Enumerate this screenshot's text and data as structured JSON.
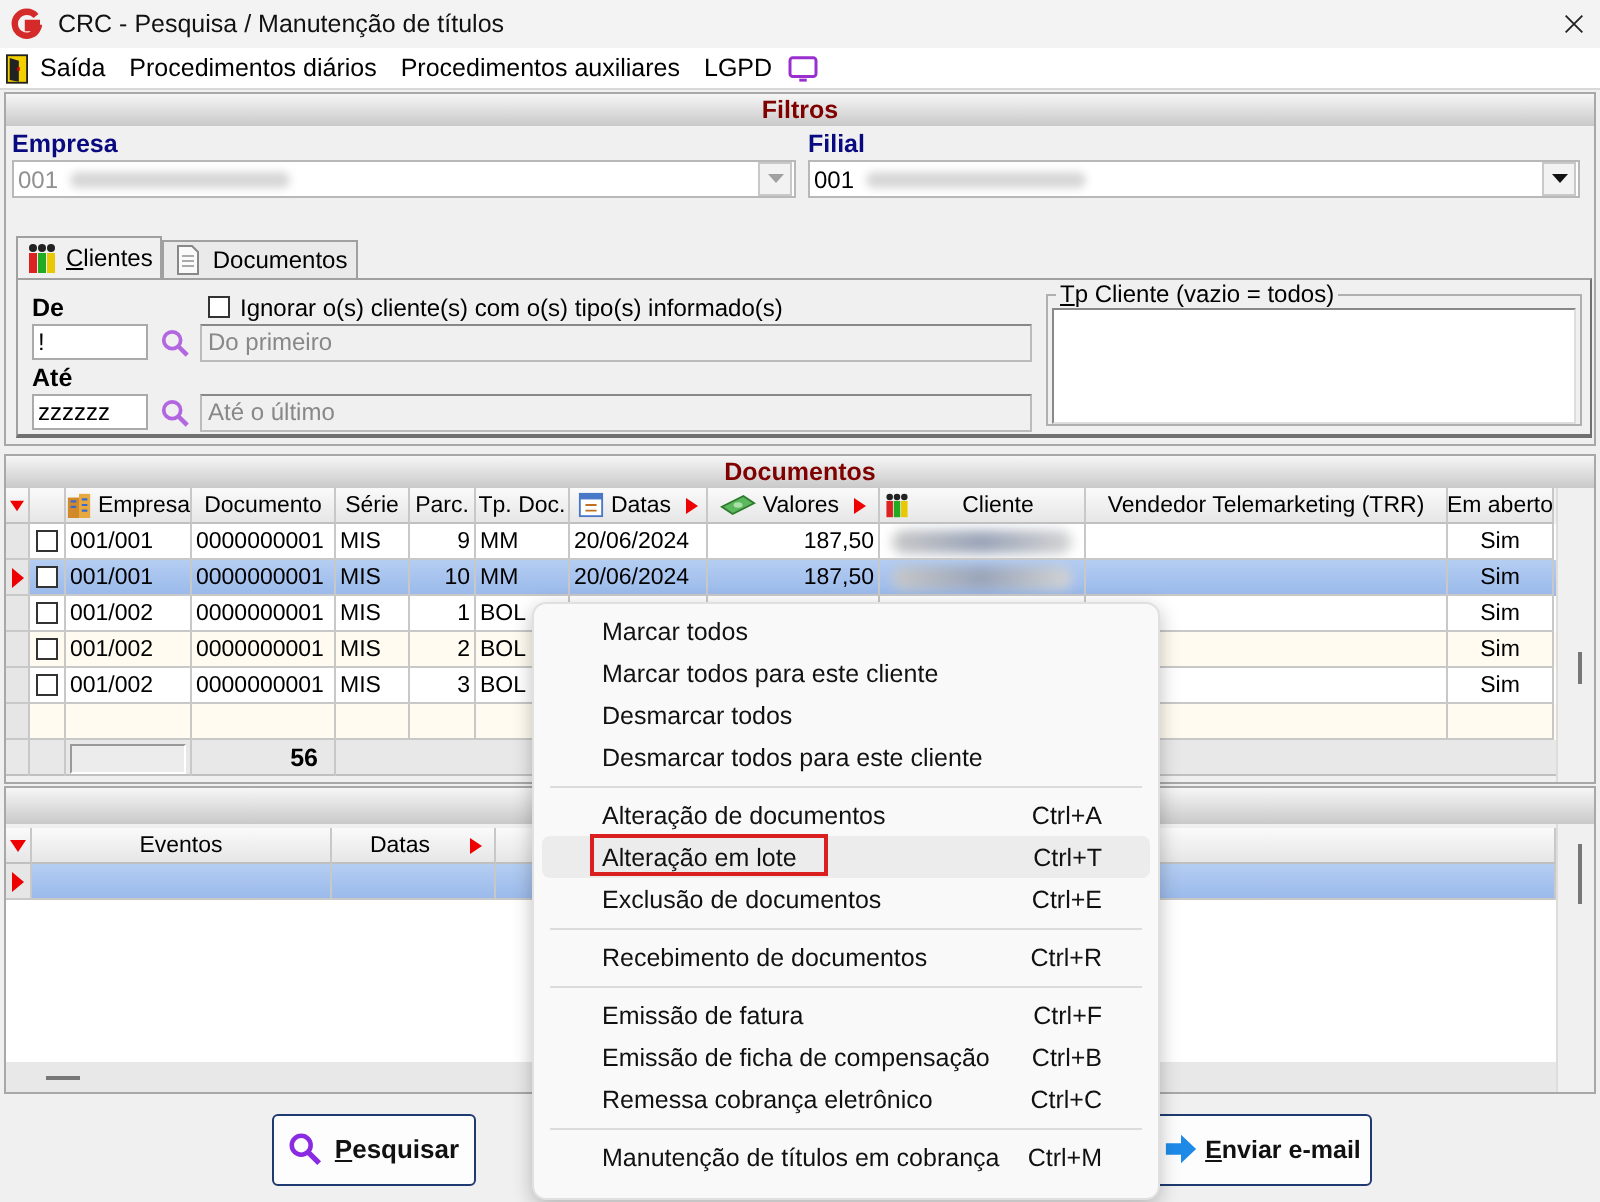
{
  "window": {
    "title": "CRC - Pesquisa / Manutenção de títulos"
  },
  "menu_bar": [
    {
      "label": "Saída"
    },
    {
      "label": "Procedimentos diários"
    },
    {
      "label": "Procedimentos auxiliares"
    },
    {
      "label": "LGPD"
    }
  ],
  "filters": {
    "title": "Filtros",
    "empresa": {
      "label": "Empresa",
      "value": "001",
      "redacted": true,
      "disabled": true
    },
    "filial": {
      "label": "Filial",
      "value": "001",
      "redacted": true,
      "disabled": false
    },
    "tabs": [
      {
        "label": "Clientes",
        "mnemonic": true,
        "selected": true
      },
      {
        "label": "Documentos",
        "mnemonic": false,
        "selected": false
      }
    ],
    "ignore_checkbox": {
      "label": "Ignorar o(s) cliente(s) com o(s) tipo(s) informado(s)",
      "checked": false
    },
    "de": {
      "label": "De",
      "value": "!",
      "description": "Do primeiro"
    },
    "ate": {
      "label": "Até",
      "value": "zzzzzz",
      "description": "Até o último"
    },
    "tp_cliente": {
      "legend": "Tp Cliente (vazio = todos)",
      "mnemonic": true
    }
  },
  "documents": {
    "title": "Documentos",
    "columns": [
      {
        "label": "Empresa",
        "sort_marker": false
      },
      {
        "label": "Documento",
        "sort_marker": false
      },
      {
        "label": "Série",
        "sort_marker": false
      },
      {
        "label": "Parc.",
        "sort_marker": false
      },
      {
        "label": "Tp. Doc.",
        "sort_marker": false
      },
      {
        "label": "Datas",
        "sort_marker": true
      },
      {
        "label": "Valores",
        "sort_marker": true
      },
      {
        "label": "Cliente",
        "sort_marker": false
      },
      {
        "label": "Vendedor Telemarketing (TRR)",
        "sort_marker": false
      },
      {
        "label": "Em aberto",
        "sort_marker": false
      }
    ],
    "rows": [
      {
        "selected": false,
        "checked": false,
        "empresa": "001/001",
        "documento": "0000000001",
        "serie": "MIS",
        "parc": "9",
        "tp_doc": "MM",
        "datas": "20/06/2024",
        "valores": "187,50",
        "cliente_redacted": true,
        "em_aberto": "Sim"
      },
      {
        "selected": true,
        "checked": false,
        "empresa": "001/001",
        "documento": "0000000001",
        "serie": "MIS",
        "parc": "10",
        "tp_doc": "MM",
        "datas": "20/06/2024",
        "valores": "187,50",
        "cliente_redacted": true,
        "em_aberto": "Sim"
      },
      {
        "selected": false,
        "checked": false,
        "empresa": "001/002",
        "documento": "0000000001",
        "serie": "MIS",
        "parc": "1",
        "tp_doc": "BOL",
        "em_aberto": "Sim"
      },
      {
        "selected": false,
        "checked": false,
        "empresa": "001/002",
        "documento": "0000000001",
        "serie": "MIS",
        "parc": "2",
        "tp_doc": "BOL",
        "em_aberto": "Sim"
      },
      {
        "selected": false,
        "checked": false,
        "empresa": "001/002",
        "documento": "0000000001",
        "serie": "MIS",
        "parc": "3",
        "tp_doc": "BOL",
        "em_aberto": "Sim"
      }
    ],
    "total": "56"
  },
  "events": {
    "columns": [
      {
        "label": "Eventos",
        "sort_marker": false
      },
      {
        "label": "Datas",
        "sort_marker": true
      }
    ],
    "rows": [
      {
        "selected": true
      }
    ]
  },
  "buttons": [
    {
      "label": "Pesquisar",
      "mnemonic": true,
      "kind": "search"
    },
    {
      "label": "Enviar e-mail",
      "mnemonic": true,
      "kind": "send"
    }
  ],
  "context_menu": {
    "groups": [
      {
        "items": [
          {
            "label": "Marcar todos",
            "selected": false
          },
          {
            "label": "Marcar todos para este cliente",
            "selected": false
          },
          {
            "label": "Desmarcar todos",
            "selected": false
          },
          {
            "label": "Desmarcar todos para este cliente",
            "selected": false
          }
        ]
      },
      {
        "items": [
          {
            "label": "Alteração de documentos",
            "shortcut": "Ctrl+A",
            "selected": false
          },
          {
            "label": "Alteração em lote",
            "shortcut": "Ctrl+T",
            "selected": true
          },
          {
            "label": "Exclusão de documentos",
            "shortcut": "Ctrl+E",
            "selected": false
          }
        ]
      },
      {
        "items": [
          {
            "label": "Recebimento de documentos",
            "shortcut": "Ctrl+R",
            "selected": false
          }
        ]
      },
      {
        "items": [
          {
            "label": "Emissão de fatura",
            "shortcut": "Ctrl+F",
            "selected": false
          },
          {
            "label": "Emissão de ficha de compensação",
            "shortcut": "Ctrl+B",
            "selected": false
          },
          {
            "label": "Remessa cobrança eletrônico",
            "shortcut": "Ctrl+C",
            "selected": false
          }
        ]
      },
      {
        "items": [
          {
            "label": "Manutenção de títulos em cobrança",
            "shortcut": "Ctrl+M",
            "selected": false
          }
        ]
      }
    ]
  }
}
